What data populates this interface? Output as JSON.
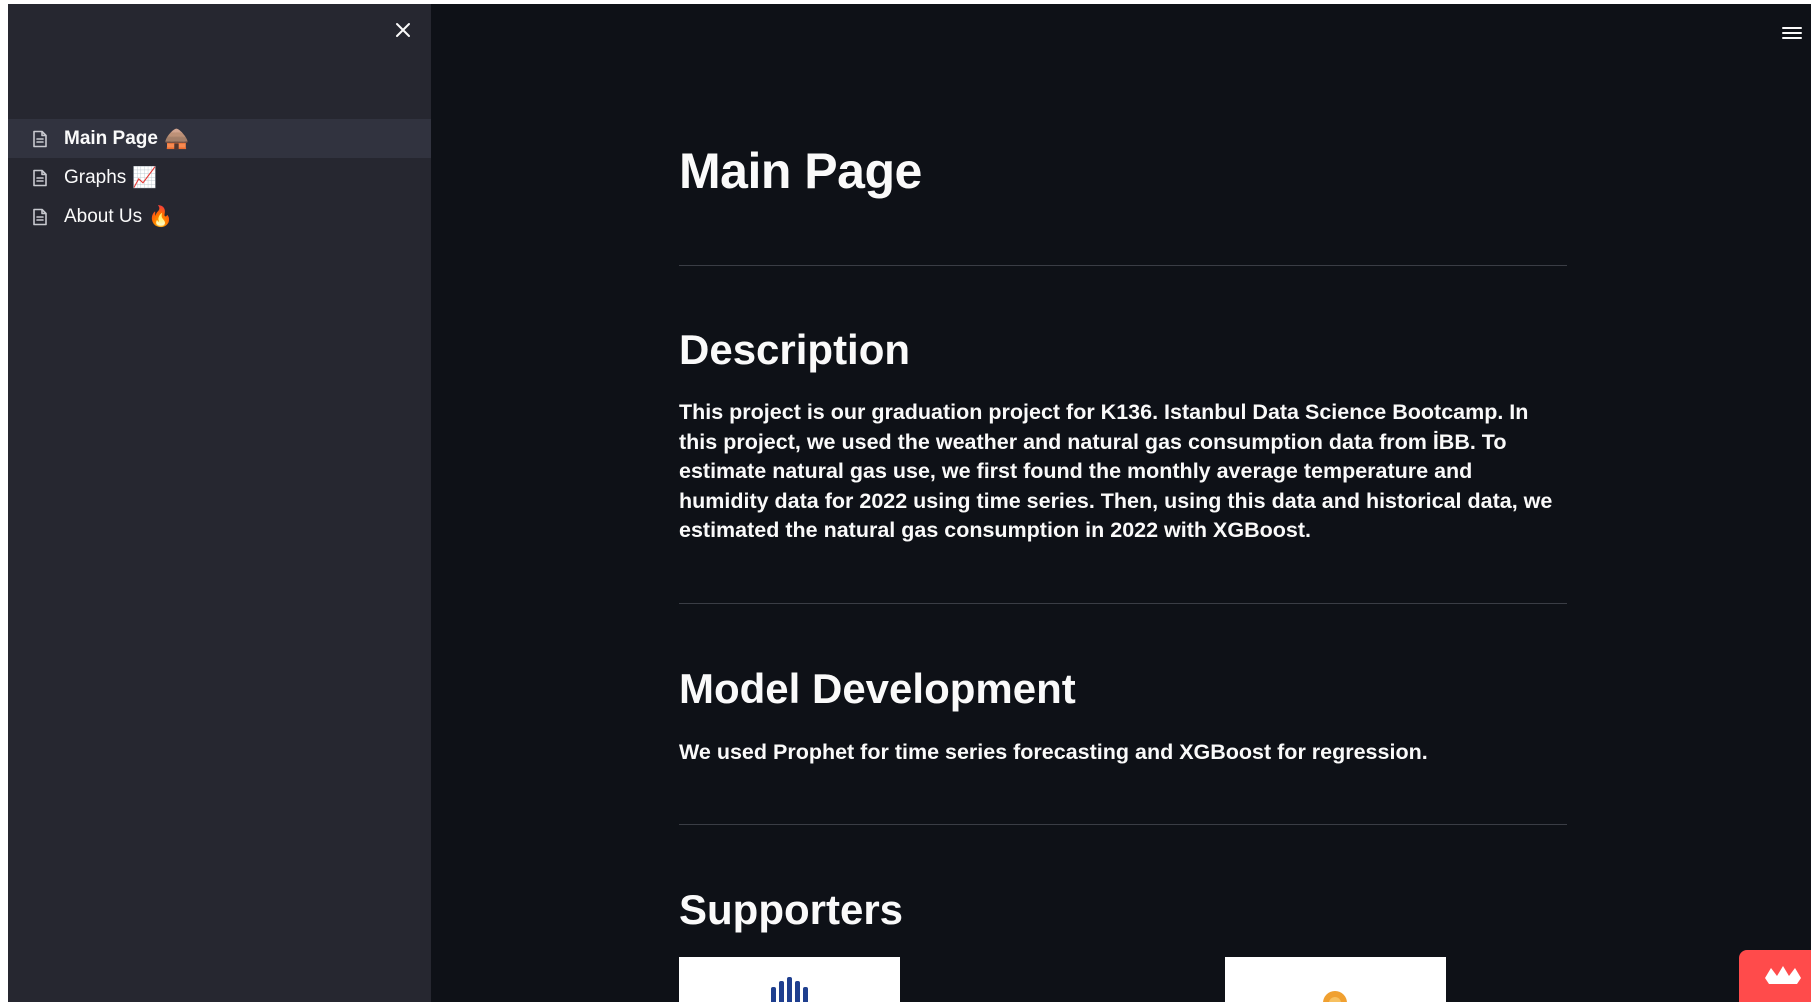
{
  "sidebar": {
    "close_icon": "close-icon",
    "items": [
      {
        "label": "Main Page",
        "emoji": "🛖",
        "icon": "page-icon",
        "active": true
      },
      {
        "label": "Graphs",
        "emoji": "📈",
        "icon": "page-icon",
        "active": false
      },
      {
        "label": "About Us",
        "emoji": "🔥",
        "icon": "page-icon",
        "active": false
      }
    ]
  },
  "header": {
    "menu_icon": "hamburger-menu-icon"
  },
  "main": {
    "title": "Main Page",
    "sections": [
      {
        "heading": "Description",
        "text": "This project is our graduation project for K136. Istanbul Data Science Bootcamp. In this project, we used the weather and natural gas consumption data from İBB. To estimate natural gas use, we first found the monthly average temperature and humidity data for 2022 using time series. Then, using this data and historical data, we estimated the natural gas consumption in 2022 with XGBoost."
      },
      {
        "heading": "Model Development",
        "text": "We used Prophet for time series forecasting and XGBoost for regression."
      },
      {
        "heading": "Supporters",
        "text": ""
      }
    ]
  },
  "colors": {
    "app_background": "#0e1117",
    "sidebar_background": "#262730",
    "active_item_background": "#31333f",
    "text": "#fafafa",
    "badge": "#ff4b4b"
  }
}
